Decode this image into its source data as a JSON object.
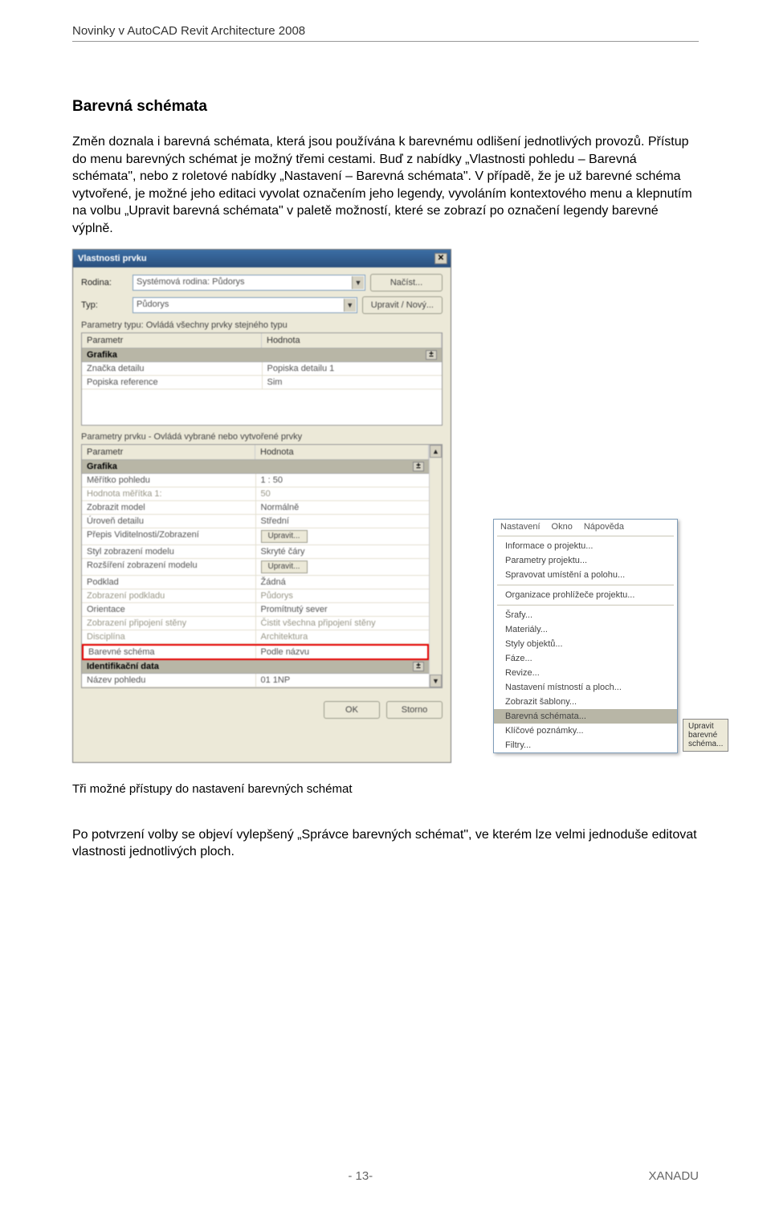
{
  "doc": {
    "header": "Novinky v AutoCAD Revit Architecture 2008",
    "page_num": "- 13-",
    "brand": "XANADU"
  },
  "section": {
    "title": "Barevná schémata",
    "p1": "Změn doznala i barevná schémata, která jsou používána k barevnému odlišení jednotlivých provozů. Přístup do menu barevných schémat je možný třemi cestami. Buď z nabídky „Vlastnosti pohledu – Barevná schémata\", nebo z roletové nabídky „Nastavení – Barevná schémata\". V případě, že je už barevné schéma vytvořené, je možné jeho editaci vyvolat označením jeho legendy, vyvoláním kontextového menu a klepnutím na volbu „Upravit barevná schémata\" v paletě možností, které se zobrazí po označení legendy barevné výplně.",
    "caption": "Tři možné přístupy do nastavení barevných schémat",
    "p2": "Po potvrzení volby se objeví vylepšený „Správce barevných schémat\", ve kterém lze velmi jednoduše editovat vlastnosti jednotlivých ploch."
  },
  "dialog": {
    "title": "Vlastnosti prvku",
    "labels": {
      "rodina": "Rodina:",
      "typ": "Typ:"
    },
    "rodina_value": "Systémová rodina: Půdorys",
    "typ_value": "Půdorys",
    "btn_load": "Načíst...",
    "btn_edit_new": "Upravit / Nový...",
    "help_typu": "Parametry typu: Ovládá všechny prvky stejného typu",
    "help_prvku": "Parametry prvku - Ovládá vybrané nebo vytvořené prvky",
    "col_param": "Parametr",
    "col_val": "Hodnota",
    "groups": {
      "grafika": "Grafika",
      "ident": "Identifikační data"
    },
    "typu_rows": [
      {
        "p": "Značka detailu",
        "v": "Popiska detailu 1"
      },
      {
        "p": "Popiska reference",
        "v": "Sim"
      }
    ],
    "prvku_rows": [
      {
        "p": "Měřítko pohledu",
        "v": "1 : 50"
      },
      {
        "p": "Hodnota měřítka  1:",
        "v": "50",
        "dis": true
      },
      {
        "p": "Zobrazit model",
        "v": "Normálně"
      },
      {
        "p": "Úroveň detailu",
        "v": "Střední"
      },
      {
        "p": "Přepis Viditelnosti/Zobrazení",
        "v": "",
        "btn": "Upravit..."
      },
      {
        "p": "Styl zobrazení modelu",
        "v": "Skryté čáry"
      },
      {
        "p": "Rozšíření zobrazení modelu",
        "v": "",
        "btn": "Upravit..."
      },
      {
        "p": "Podklad",
        "v": "Žádná"
      },
      {
        "p": "Zobrazení podkladu",
        "v": "Půdorys",
        "dis": true
      },
      {
        "p": "Orientace",
        "v": "Promítnutý sever"
      },
      {
        "p": "Zobrazení připojení stěny",
        "v": "Čistit všechna připojení stěny",
        "dis": true
      },
      {
        "p": "Disciplína",
        "v": "Architektura",
        "dis": true
      },
      {
        "p": "Barevné schéma",
        "v": "Podle názvu",
        "hl": true
      }
    ],
    "ident_rows": [
      {
        "p": "Název pohledu",
        "v": "01 1NP"
      }
    ],
    "btn_ok": "OK",
    "btn_cancel": "Storno",
    "collapse": "±"
  },
  "menu": {
    "head": [
      "Nastavení",
      "Okno",
      "Nápověda"
    ],
    "items_top": [
      "Informace o projektu...",
      "Parametry projektu...",
      "Spravovat umístění a polohu..."
    ],
    "org": "Organizace prohlížeče projektu...",
    "items_mid": [
      "Šrafy...",
      "Materiály...",
      "Styly objektů...",
      "Fáze...",
      "Revize...",
      "Nastavení místností a ploch...",
      "Zobrazit šablony..."
    ],
    "highlighted": "Barevná schémata...",
    "items_bot": [
      "Klíčové poznámky...",
      "Filtry..."
    ]
  },
  "chip": "Upravit barevné schéma..."
}
